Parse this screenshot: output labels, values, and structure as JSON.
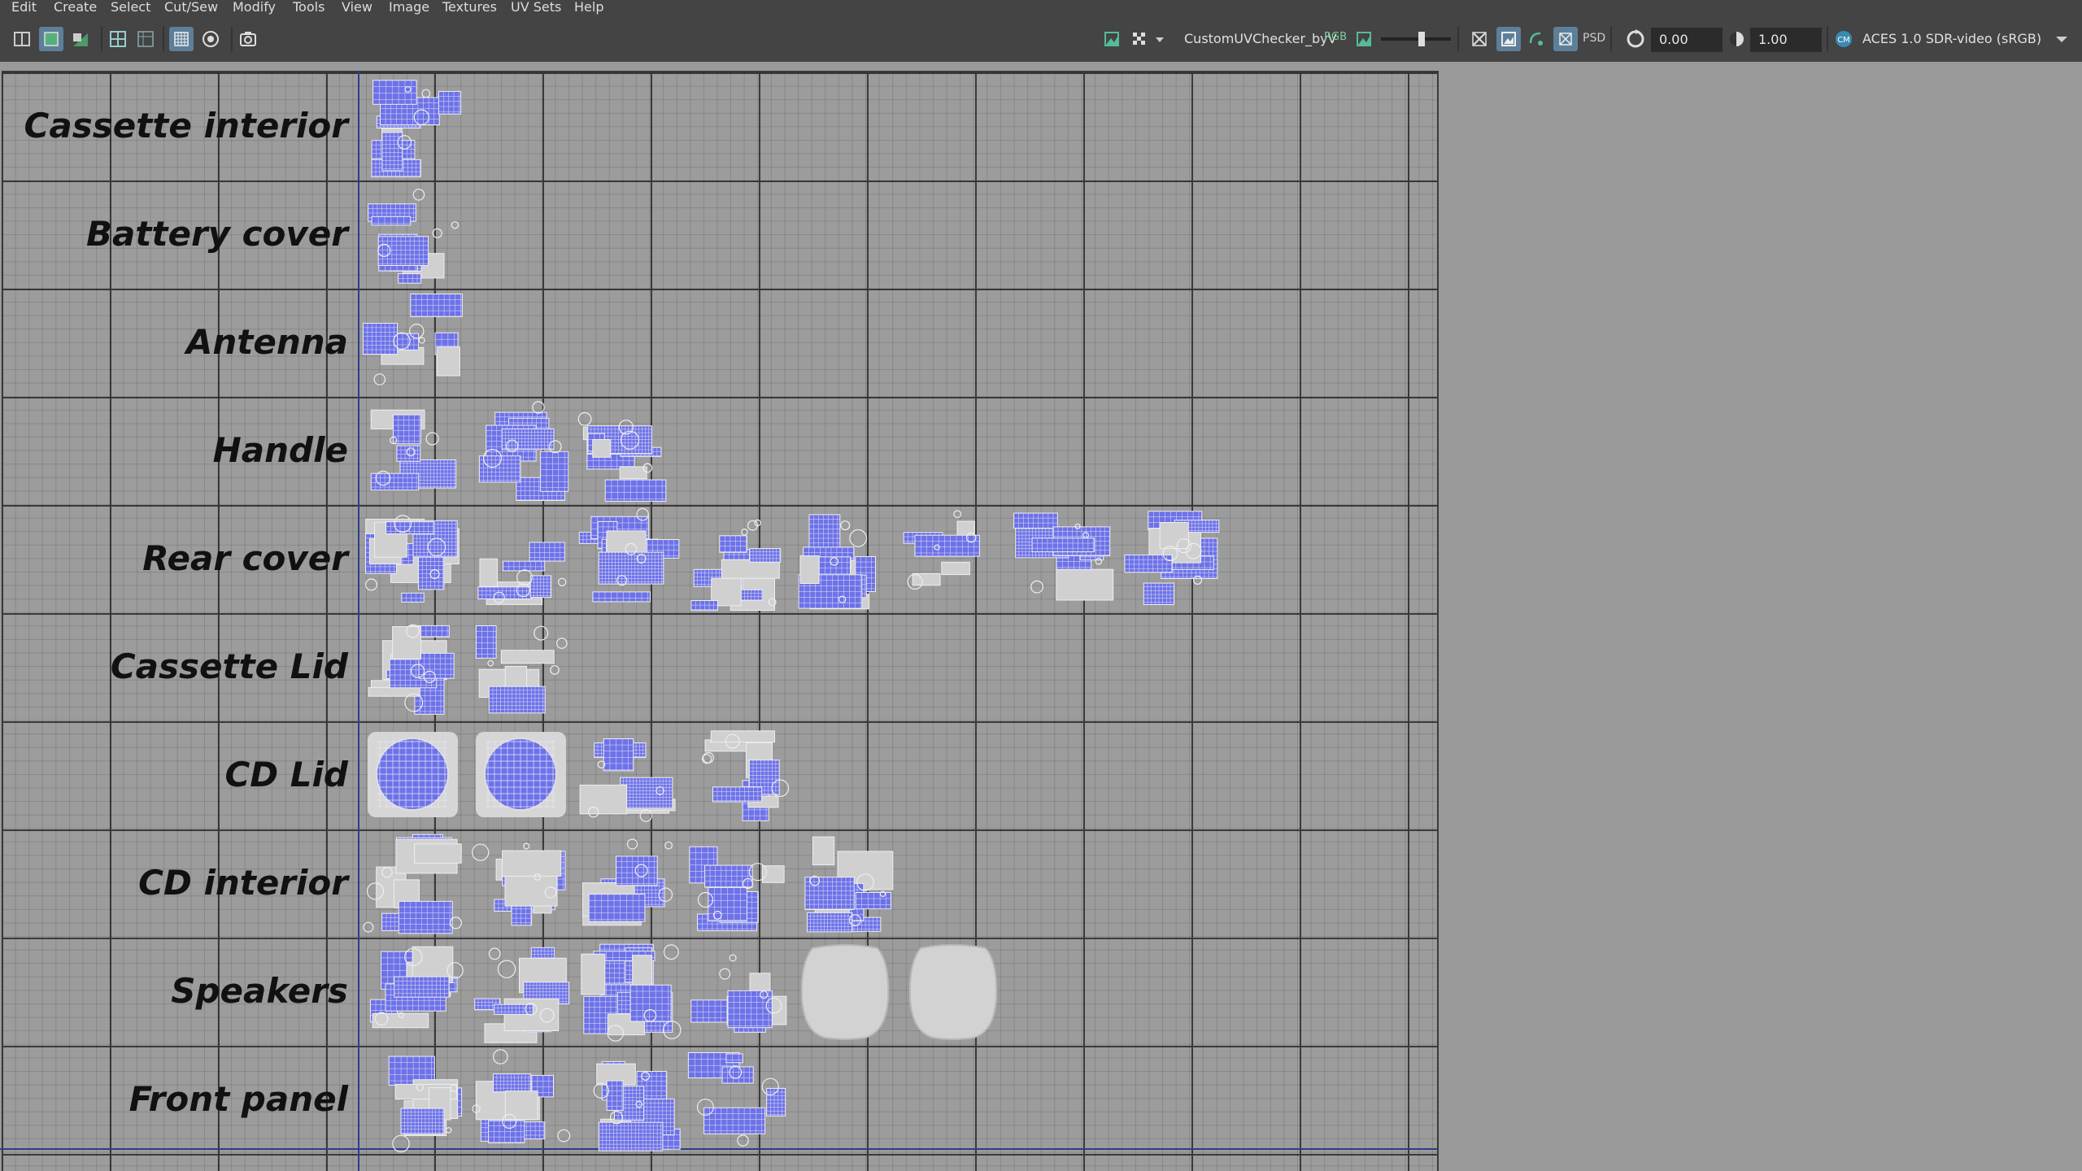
{
  "menubar": {
    "items": [
      "Edit",
      "Create",
      "Select",
      "Cut/Sew",
      "Modify",
      "Tools",
      "View",
      "Image",
      "Textures",
      "UV Sets",
      "Help"
    ]
  },
  "toolbar": {
    "texture_name": "CustomUVChecker_byV",
    "channel_label": "RGB",
    "exposure_value": "0.00",
    "gamma_value": "1.00",
    "color_space": "ACES 1.0 SDR-video (sRGB)",
    "psd_label": "PSD",
    "left_icons": [
      "uv-snapshot-icon",
      "shaded-uv-icon",
      "distortion-icon",
      "grid-toggle-icon",
      "pixel-snap-icon",
      "checker-display-icon",
      "isolate-icon",
      "camera-snapshot-icon"
    ],
    "right_icons": [
      "image-display-icon",
      "checker-pattern-icon",
      "dropdown-icon",
      "channel-rgb-icon",
      "image-toggle-icon",
      "brightness-slider-icon",
      "texture-borders-icon",
      "dim-image-icon",
      "refresh-icon",
      "uv-shell-icon",
      "psd-icon",
      "exposure-icon",
      "gamma-icon",
      "color-management-icon",
      "color-space-dropdown-icon"
    ]
  },
  "colors": {
    "uv_blue": "#6d72e8",
    "tile_bg": "#c9c9c9",
    "label_text": "#111111",
    "grid_line": "#3a3a3a",
    "menubar_bg": "#444444"
  },
  "rows": [
    {
      "label": "Cassette interior",
      "tiles": 1
    },
    {
      "label": "Battery cover",
      "tiles": 1
    },
    {
      "label": "Antenna",
      "tiles": 1
    },
    {
      "label": "Handle",
      "tiles": 3
    },
    {
      "label": "Rear cover",
      "tiles": 8
    },
    {
      "label": "Cassette Lid",
      "tiles": 2
    },
    {
      "label": "CD Lid",
      "tiles": 4
    },
    {
      "label": "CD interior",
      "tiles": 5
    },
    {
      "label": "Speakers",
      "tiles": 6
    },
    {
      "label": "Front panel",
      "tiles": 4
    }
  ]
}
